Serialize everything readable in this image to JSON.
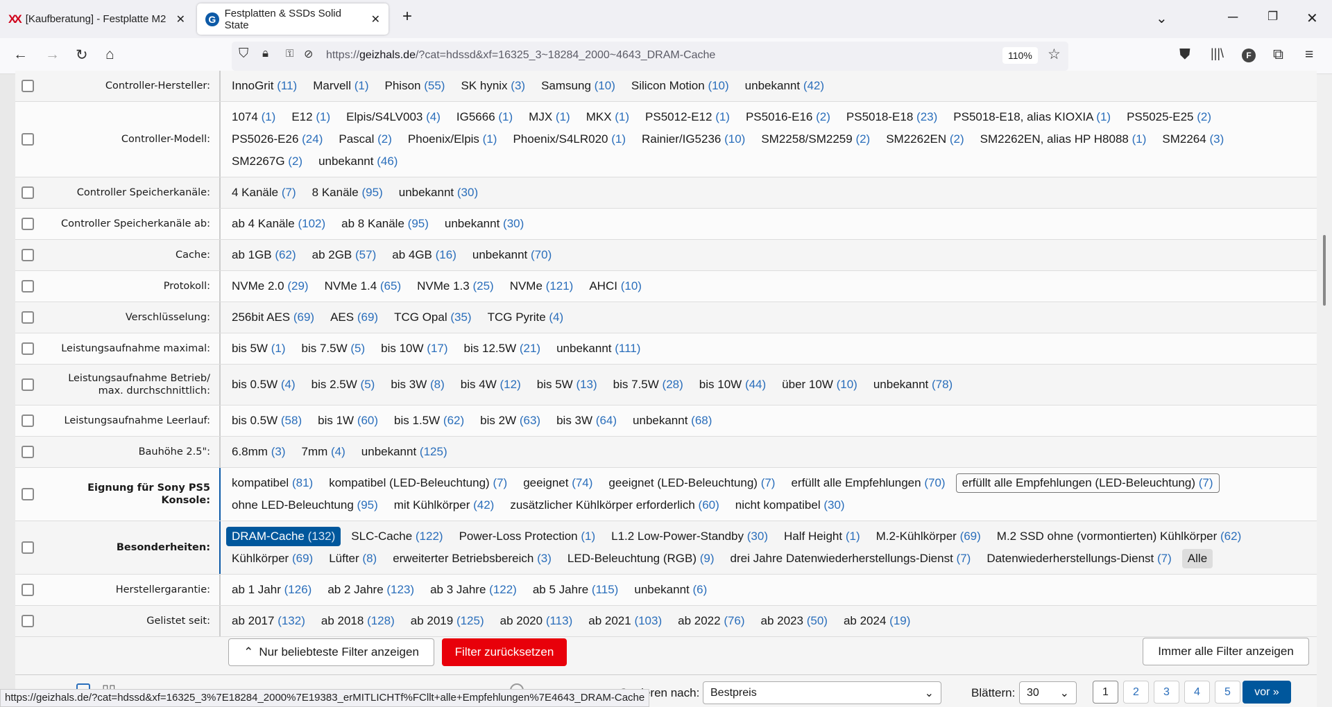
{
  "browser": {
    "tabs": [
      {
        "title": "[Kaufberatung] - Festplatte M2",
        "icon": "x-logo-icon"
      },
      {
        "title": "Festplatten & SSDs Solid State",
        "icon": "geizhals-g-icon",
        "active": true
      }
    ],
    "url_prefix": "https://",
    "url_domain": "geizhals.de",
    "url_rest": "/?cat=hdssd&xf=16325_3~18284_2000~4643_DRAM-Cache",
    "zoom": "110%",
    "status_url": "https://geizhals.de/?cat=hdssd&xf=16325_3%7E18284_2000%7E19383_erMITLICHTf%FCllt+alle+Empfehlungen%7E4643_DRAM-Cache"
  },
  "filters": [
    {
      "label": "Controller-Hersteller:",
      "options": [
        [
          "InnoGrit",
          "(11)"
        ],
        [
          "Marvell",
          "(1)"
        ],
        [
          "Phison",
          "(55)"
        ],
        [
          "SK hynix",
          "(3)"
        ],
        [
          "Samsung",
          "(10)"
        ],
        [
          "Silicon Motion",
          "(10)"
        ],
        [
          "unbekannt",
          "(42)"
        ]
      ]
    },
    {
      "label": "Controller-Modell:",
      "options": [
        [
          "1074",
          "(1)"
        ],
        [
          "E12",
          "(1)"
        ],
        [
          "Elpis/S4LV003",
          "(4)"
        ],
        [
          "IG5666",
          "(1)"
        ],
        [
          "MJX",
          "(1)"
        ],
        [
          "MKX",
          "(1)"
        ],
        [
          "PS5012-E12",
          "(1)"
        ],
        [
          "PS5016-E16",
          "(2)"
        ],
        [
          "PS5018-E18",
          "(23)"
        ],
        [
          "PS5018-E18, alias KIOXIA",
          "(1)"
        ],
        [
          "PS5025-E25",
          "(2)"
        ],
        [
          "PS5026-E26",
          "(24)"
        ],
        [
          "Pascal",
          "(2)"
        ],
        [
          "Phoenix/Elpis",
          "(1)"
        ],
        [
          "Phoenix/S4LR020",
          "(1)"
        ],
        [
          "Rainier/IG5236",
          "(10)"
        ],
        [
          "SM2258/SM2259",
          "(2)"
        ],
        [
          "SM2262EN",
          "(2)"
        ],
        [
          "SM2262EN, alias HP H8088",
          "(1)"
        ],
        [
          "SM2264",
          "(3)"
        ],
        [
          "SM2267G",
          "(2)"
        ],
        [
          "unbekannt",
          "(46)"
        ]
      ]
    },
    {
      "label": "Controller Speicherkanäle:",
      "options": [
        [
          "4 Kanäle",
          "(7)"
        ],
        [
          "8 Kanäle",
          "(95)"
        ],
        [
          "unbekannt",
          "(30)"
        ]
      ]
    },
    {
      "label": "Controller Speicherkanäle ab:",
      "options": [
        [
          "ab 4 Kanäle",
          "(102)"
        ],
        [
          "ab 8 Kanäle",
          "(95)"
        ],
        [
          "unbekannt",
          "(30)"
        ]
      ]
    },
    {
      "label": "Cache:",
      "options": [
        [
          "ab 1GB",
          "(62)"
        ],
        [
          "ab 2GB",
          "(57)"
        ],
        [
          "ab 4GB",
          "(16)"
        ],
        [
          "unbekannt",
          "(70)"
        ]
      ]
    },
    {
      "label": "Protokoll:",
      "options": [
        [
          "NVMe 2.0",
          "(29)"
        ],
        [
          "NVMe 1.4",
          "(65)"
        ],
        [
          "NVMe 1.3",
          "(25)"
        ],
        [
          "NVMe",
          "(121)"
        ],
        [
          "AHCI",
          "(10)"
        ]
      ]
    },
    {
      "label": "Verschlüsselung:",
      "options": [
        [
          "256bit AES",
          "(69)"
        ],
        [
          "AES",
          "(69)"
        ],
        [
          "TCG Opal",
          "(35)"
        ],
        [
          "TCG Pyrite",
          "(4)"
        ]
      ]
    },
    {
      "label": "Leistungsaufnahme maximal:",
      "options": [
        [
          "bis 5W",
          "(1)"
        ],
        [
          "bis 7.5W",
          "(5)"
        ],
        [
          "bis 10W",
          "(17)"
        ],
        [
          "bis 12.5W",
          "(21)"
        ],
        [
          "unbekannt",
          "(111)"
        ]
      ]
    },
    {
      "label": "Leistungsaufnahme Betrieb/ max. durchschnittlich:",
      "options": [
        [
          "bis 0.5W",
          "(4)"
        ],
        [
          "bis 2.5W",
          "(5)"
        ],
        [
          "bis 3W",
          "(8)"
        ],
        [
          "bis 4W",
          "(12)"
        ],
        [
          "bis 5W",
          "(13)"
        ],
        [
          "bis 7.5W",
          "(28)"
        ],
        [
          "bis 10W",
          "(44)"
        ],
        [
          "über 10W",
          "(10)"
        ],
        [
          "unbekannt",
          "(78)"
        ]
      ]
    },
    {
      "label": "Leistungsaufnahme Leerlauf:",
      "options": [
        [
          "bis 0.5W",
          "(58)"
        ],
        [
          "bis 1W",
          "(60)"
        ],
        [
          "bis 1.5W",
          "(62)"
        ],
        [
          "bis 2W",
          "(63)"
        ],
        [
          "bis 3W",
          "(64)"
        ],
        [
          "unbekannt",
          "(68)"
        ]
      ]
    },
    {
      "label": "Bauhöhe 2.5\":",
      "options": [
        [
          "6.8mm",
          "(3)"
        ],
        [
          "7mm",
          "(4)"
        ],
        [
          "unbekannt",
          "(125)"
        ]
      ]
    },
    {
      "label": "Eignung für Sony PS5 Konsole:",
      "bold": true,
      "active": true,
      "options": [
        [
          "kompatibel",
          "(81)"
        ],
        [
          "kompatibel (LED-Beleuchtung)",
          "(7)"
        ],
        [
          "geeignet",
          "(74)"
        ],
        [
          "geeignet (LED-Beleuchtung)",
          "(7)"
        ],
        [
          "erfüllt alle Empfehlungen",
          "(70)"
        ],
        [
          "erfüllt alle Empfehlungen (LED-Beleuchtung)",
          "(7)",
          "outl"
        ],
        [
          "ohne LED-Beleuchtung",
          "(95)"
        ],
        [
          "mit Kühlkörper",
          "(42)"
        ],
        [
          "zusätzlicher Kühlkörper erforderlich",
          "(60)"
        ],
        [
          "nicht kompatibel",
          "(30)"
        ]
      ]
    },
    {
      "label": "Besonderheiten:",
      "bold": true,
      "active": true,
      "options": [
        [
          "DRAM-Cache",
          "(132)",
          "on"
        ],
        [
          "SLC-Cache",
          "(122)"
        ],
        [
          "Power-Loss Protection",
          "(1)"
        ],
        [
          "L1.2 Low-Power-Standby",
          "(30)"
        ],
        [
          "Half Height",
          "(1)"
        ],
        [
          "M.2-Kühlkörper",
          "(69)"
        ],
        [
          "M.2 SSD ohne (vormontierten) Kühlkörper",
          "(62)"
        ],
        [
          "Kühlkörper",
          "(69)"
        ],
        [
          "Lüfter",
          "(8)"
        ],
        [
          "erweiterter Betriebsbereich",
          "(3)"
        ],
        [
          "LED-Beleuchtung (RGB)",
          "(9)"
        ],
        [
          "drei Jahre Datenwiederherstellungs-Dienst",
          "(7)"
        ],
        [
          "Datenwiederherstellungs-Dienst",
          "(7)"
        ],
        [
          "Alle",
          "",
          "all"
        ]
      ]
    },
    {
      "label": "Herstellergarantie:",
      "options": [
        [
          "ab 1 Jahr",
          "(126)"
        ],
        [
          "ab 2 Jahre",
          "(123)"
        ],
        [
          "ab 3 Jahre",
          "(122)"
        ],
        [
          "ab 5 Jahre",
          "(115)"
        ],
        [
          "unbekannt",
          "(6)"
        ]
      ]
    },
    {
      "label": "Gelistet seit:",
      "options": [
        [
          "ab 2017",
          "(132)"
        ],
        [
          "ab 2018",
          "(128)"
        ],
        [
          "ab 2019",
          "(125)"
        ],
        [
          "ab 2020",
          "(113)"
        ],
        [
          "ab 2021",
          "(103)"
        ],
        [
          "ab 2022",
          "(76)"
        ],
        [
          "ab 2023",
          "(50)"
        ],
        [
          "ab 2024",
          "(19)"
        ]
      ]
    }
  ],
  "actions": {
    "popular": "Nur beliebteste Filter anzeigen",
    "reset": "Filter zurücksetzen",
    "show_all": "Immer alle Filter anzeigen",
    "reset_color": "#e8000a"
  },
  "listing": {
    "sort_label": "Sortieren nach:",
    "sort_value": "Bestpreis",
    "per_page_label": "Blättern:",
    "per_page": "30",
    "pages": [
      "1",
      "2",
      "3",
      "4",
      "5"
    ],
    "current_page": "1",
    "next": "vor »",
    "accent": "#00579c"
  }
}
